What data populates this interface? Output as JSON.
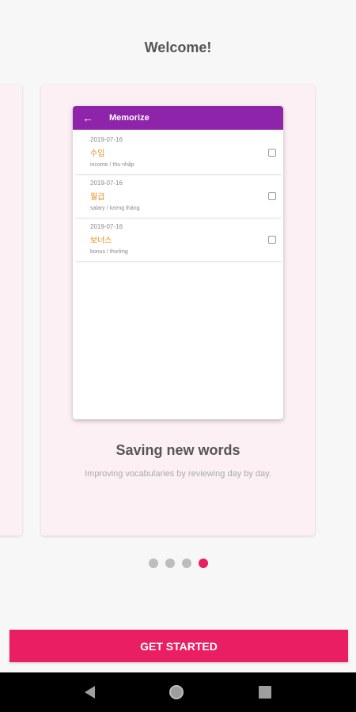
{
  "header": {
    "title": "Welcome!"
  },
  "preview": {
    "app_title": "Memorize",
    "words": [
      {
        "date": "2019-07-16",
        "korean": "수입",
        "meaning": "income / thu nhập"
      },
      {
        "date": "2019-07-16",
        "korean": "월급",
        "meaning": "salary / lương tháng"
      },
      {
        "date": "2019-07-16",
        "korean": "보너스",
        "meaning": "bonus / thưởng"
      }
    ]
  },
  "slide": {
    "heading": "Saving new words",
    "description": "Improving vocabularies by reviewing day by day."
  },
  "pager": {
    "count": 4,
    "active_index": 3
  },
  "actions": {
    "get_started_label": "GET STARTED"
  },
  "colors": {
    "accent": "#e91e63",
    "appbar": "#8e24aa",
    "word": "#ef8a1e",
    "card": "#fcf0f4"
  }
}
